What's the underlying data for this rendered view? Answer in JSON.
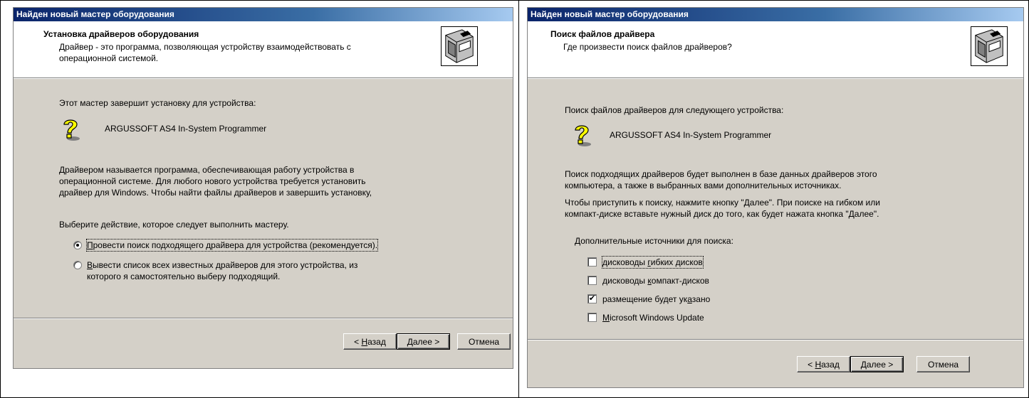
{
  "left": {
    "title": "Найден новый мастер оборудования",
    "header_title": "Установка драйверов оборудования",
    "header_sub_line1": "Драйвер - это программа, позволяющая устройству взаимодействовать с",
    "header_sub_line2": "операционной системой.",
    "intro": "Этот мастер завершит установку для устройства:",
    "device": "ARGUSSOFT AS4 In-System Programmer",
    "para_line1": "Драйвером называется программа, обеспечивающая работу устройства в",
    "para_line2": "операционной системе. Для любого нового устройства требуется установить",
    "para_line3": "драйвер для Windows. Чтобы найти файлы драйверов и завершить установку,",
    "choose": "Выберите действие, которое следует выполнить мастеру.",
    "radio1_ul": "П",
    "radio1_rest": "ровести поиск подходящего драйвера для устройства (рекомендуется).",
    "radio2_ul": "В",
    "radio2_rest": "ывести список всех известных драйверов для этого устройства, из",
    "radio2_line2": "которого я самостоятельно выберу подходящий.",
    "back_lt": "< ",
    "back_ul": "Н",
    "back_rest": "азад",
    "next": "Далее >",
    "cancel": "Отмена"
  },
  "right": {
    "title": "Найден новый мастер оборудования",
    "header_title": "Поиск файлов драйвера",
    "header_sub": "Где произвести поиск файлов драйверов?",
    "intro": "Поиск файлов драйверов для следующего устройства:",
    "device": "ARGUSSOFT AS4 In-System Programmer",
    "para1_line1": "Поиск подходящих драйверов будет выполнен в базе данных драйверов этого",
    "para1_line2": "компьютера, а также в выбранных вами дополнительных источниках.",
    "para2_line1": "Чтобы приступить к поиску, нажмите кнопку \"Далее\". При поиске на гибком или",
    "para2_line2": "компакт-диске вставьте нужный диск до того, как будет нажата кнопка \"Далее\".",
    "sources_label": "Дополнительные источники для поиска:",
    "checks": [
      {
        "pre": "дисководы ",
        "ul": "г",
        "post": "ибких дисков",
        "checked": false
      },
      {
        "pre": "дисководы ",
        "ul": "к",
        "post": "омпакт-дисков",
        "checked": false
      },
      {
        "pre": "размещение будет ук",
        "ul": "а",
        "post": "зано",
        "checked": true
      },
      {
        "pre": "",
        "ul": "M",
        "post": "icrosoft Windows Update",
        "checked": false
      }
    ],
    "back_lt": "< ",
    "back_ul": "Н",
    "back_rest": "азад",
    "next": "Далее >",
    "cancel": "Отмена"
  }
}
